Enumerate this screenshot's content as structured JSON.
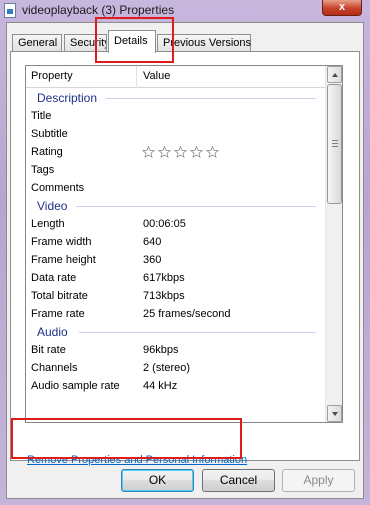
{
  "window": {
    "title": "videoplayback (3) Properties",
    "close_glyph": "x"
  },
  "tabs": [
    {
      "label": "General"
    },
    {
      "label": "Security"
    },
    {
      "label": "Details"
    },
    {
      "label": "Previous Versions"
    }
  ],
  "active_tab": "Details",
  "columns": {
    "property": "Property",
    "value": "Value"
  },
  "groups": {
    "description": "Description",
    "video": "Video",
    "audio": "Audio"
  },
  "description_rows": [
    {
      "key": "Title",
      "value": ""
    },
    {
      "key": "Subtitle",
      "value": ""
    },
    {
      "key": "Rating",
      "value": ""
    },
    {
      "key": "Tags",
      "value": ""
    },
    {
      "key": "Comments",
      "value": ""
    }
  ],
  "rating": {
    "stars_total": 5,
    "stars_filled": 0
  },
  "video_rows": [
    {
      "key": "Length",
      "value": "00:06:05"
    },
    {
      "key": "Frame width",
      "value": "640"
    },
    {
      "key": "Frame height",
      "value": "360"
    },
    {
      "key": "Data rate",
      "value": "617kbps"
    },
    {
      "key": "Total bitrate",
      "value": "713kbps"
    },
    {
      "key": "Frame rate",
      "value": "25 frames/second"
    }
  ],
  "audio_rows": [
    {
      "key": "Bit rate",
      "value": "96kbps"
    },
    {
      "key": "Channels",
      "value": "2 (stereo)"
    },
    {
      "key": "Audio sample rate",
      "value": "44 kHz"
    }
  ],
  "remove_link": "Remove Properties and Personal Information",
  "buttons": {
    "ok": "OK",
    "cancel": "Cancel",
    "apply": "Apply"
  },
  "colors": {
    "highlight": "#e01b1b",
    "group_header": "#1e3287",
    "link": "#0066cc"
  }
}
